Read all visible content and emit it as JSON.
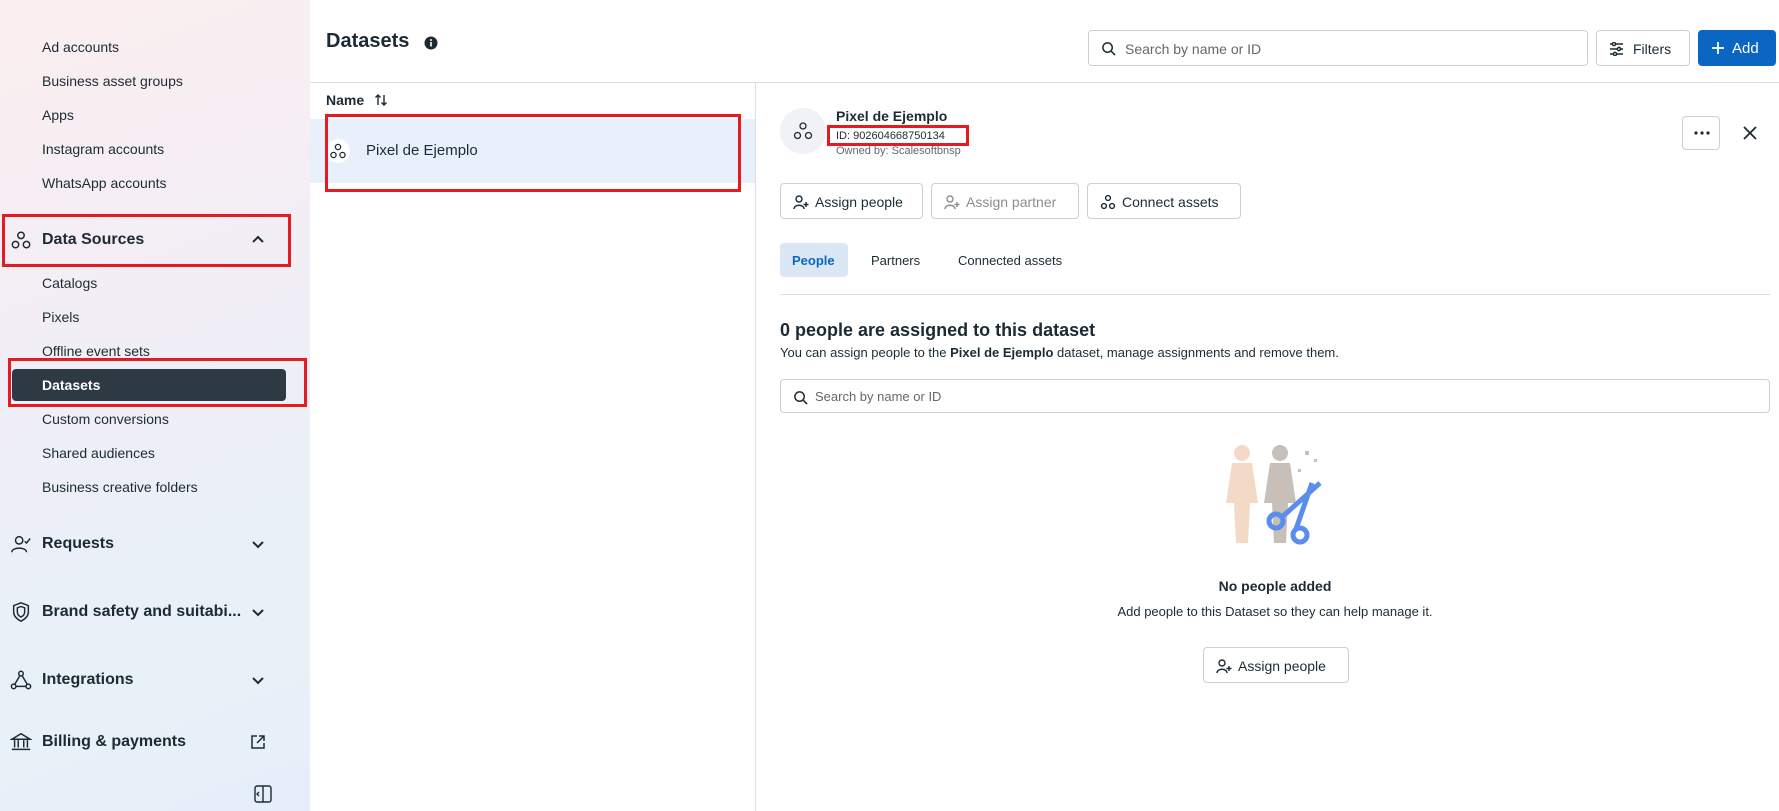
{
  "sidebar": {
    "items_top": [
      "Ad accounts",
      "Business asset groups",
      "Apps",
      "Instagram accounts",
      "WhatsApp accounts"
    ],
    "data_sources": {
      "label": "Data Sources",
      "items": [
        "Catalogs",
        "Pixels",
        "Offline event sets",
        "Datasets",
        "Custom conversions",
        "Shared audiences",
        "Business creative folders"
      ]
    },
    "sections": [
      "Requests",
      "Brand safety and suitabi...",
      "Integrations",
      "Billing & payments"
    ]
  },
  "header": {
    "title": "Datasets",
    "search_placeholder": "Search by name or ID",
    "filters_label": "Filters",
    "add_label": "Add"
  },
  "list": {
    "column_name": "Name",
    "rows": [
      "Pixel de Ejemplo"
    ]
  },
  "detail": {
    "name": "Pixel de Ejemplo",
    "id": "ID: 902604668750134",
    "owner": "Owned by: Scalesoftbnsp",
    "actions": [
      "Assign people",
      "Assign partner",
      "Connect assets"
    ],
    "tabs": [
      "People",
      "Partners",
      "Connected assets"
    ],
    "people_title": "0 people are assigned to this dataset",
    "people_desc_prefix": "You can assign people to the ",
    "people_desc_bold": "Pixel de Ejemplo",
    "people_desc_suffix": " dataset, manage assignments and remove them.",
    "search_placeholder": "Search by name or ID",
    "empty_title": "No people added",
    "empty_desc": "Add people to this Dataset so they can help manage it.",
    "empty_button": "Assign people"
  },
  "colors": {
    "primary": "#0a66c2",
    "active_nav": "#2d3a44",
    "highlight": "#e41b23"
  }
}
